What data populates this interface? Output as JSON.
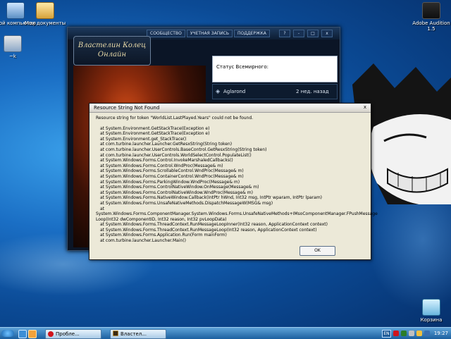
{
  "desktop": {
    "icons": [
      {
        "label": "Мой компьютер",
        "icon": "my-computer-icon"
      },
      {
        "label": "Мои документы",
        "icon": "my-documents-icon"
      },
      {
        "label": "~k",
        "icon": "setup-icon"
      },
      {
        "label": "Adobe Audition 1.5",
        "icon": "adobe-audition-icon"
      },
      {
        "label": "Корзина",
        "icon": "recycle-bin-icon"
      }
    ]
  },
  "launcher": {
    "logo_line1": "Властелин Колец",
    "logo_line2": "Онлайн",
    "nav": [
      "СООБЩЕСТВО",
      "УЧЕТНАЯ ЗАПИСЬ",
      "ПОДДЕРЖКА"
    ],
    "controls": [
      "?",
      "-",
      "□",
      "x"
    ],
    "status_label": "Статус Всемирного:",
    "server_name": "Aglarond",
    "server_last_played": "2 нед. назад"
  },
  "dialog": {
    "title": "Resource String Not Found",
    "close": "x",
    "message": "Resource string for token \"WorldList.LastPlayed.Years\" could not be found.",
    "stack_trace": [
      "at System.Environment.GetStackTrace(Exception e)",
      "at System.Environment.GetStackTrace(Exception e)",
      "at System.Environment.get_StackTrace()",
      "at com.turbine.launcher.Launcher.GetResxString(String token)",
      "at com.turbine.launcher.UserControls.BaseControl.GetResxString(String token)",
      "at com.turbine.launcher.UserControls.WorldSelectControl.PopulateList()",
      "at System.Windows.Forms.Control.InvokeMarshaledCallbacks()",
      "at System.Windows.Forms.Control.WndProc(Message& m)",
      "at System.Windows.Forms.ScrollableControl.WndProc(Message& m)",
      "at System.Windows.Forms.ContainerControl.WndProc(Message& m)",
      "at System.Windows.Forms.ParkingWindow.WndProc(Message& m)",
      "at System.Windows.Forms.ControlNativeWindow.OnMessage(Message& m)",
      "at System.Windows.Forms.ControlNativeWindow.WndProc(Message& m)",
      "at System.Windows.Forms.NativeWindow.Callback(IntPtr hWnd, Int32 msg, IntPtr wparam, IntPtr lparam)",
      "at System.Windows.Forms.UnsafeNativeMethods.DispatchMessageW(MSG& msg)",
      "at",
      "System.Windows.Forms.ComponentManager.System.Windows.Forms.UnsafeNativeMethods+IMsoComponentManager.FPushMessage",
      "Loop(Int32 dwComponentID, Int32 reason, Int32 pvLoopData)",
      "at System.Windows.Forms.ThreadContext.RunMessageLoopInner(Int32 reason, ApplicationContext context)",
      "at System.Windows.Forms.ThreadContext.RunMessageLoop(Int32 reason, ApplicationContext context)",
      "at System.Windows.Forms.Application.Run(Form mainForm)",
      "at com.turbine.launcher.Launcher.Main()"
    ],
    "ok_label": "OK"
  },
  "taskbar": {
    "tasks": [
      {
        "label": "Пробле...",
        "icon": "opera-icon"
      },
      {
        "label": "Властел...",
        "icon": "lotro-launcher-icon"
      }
    ],
    "language": "EN",
    "clock": "19:27"
  }
}
